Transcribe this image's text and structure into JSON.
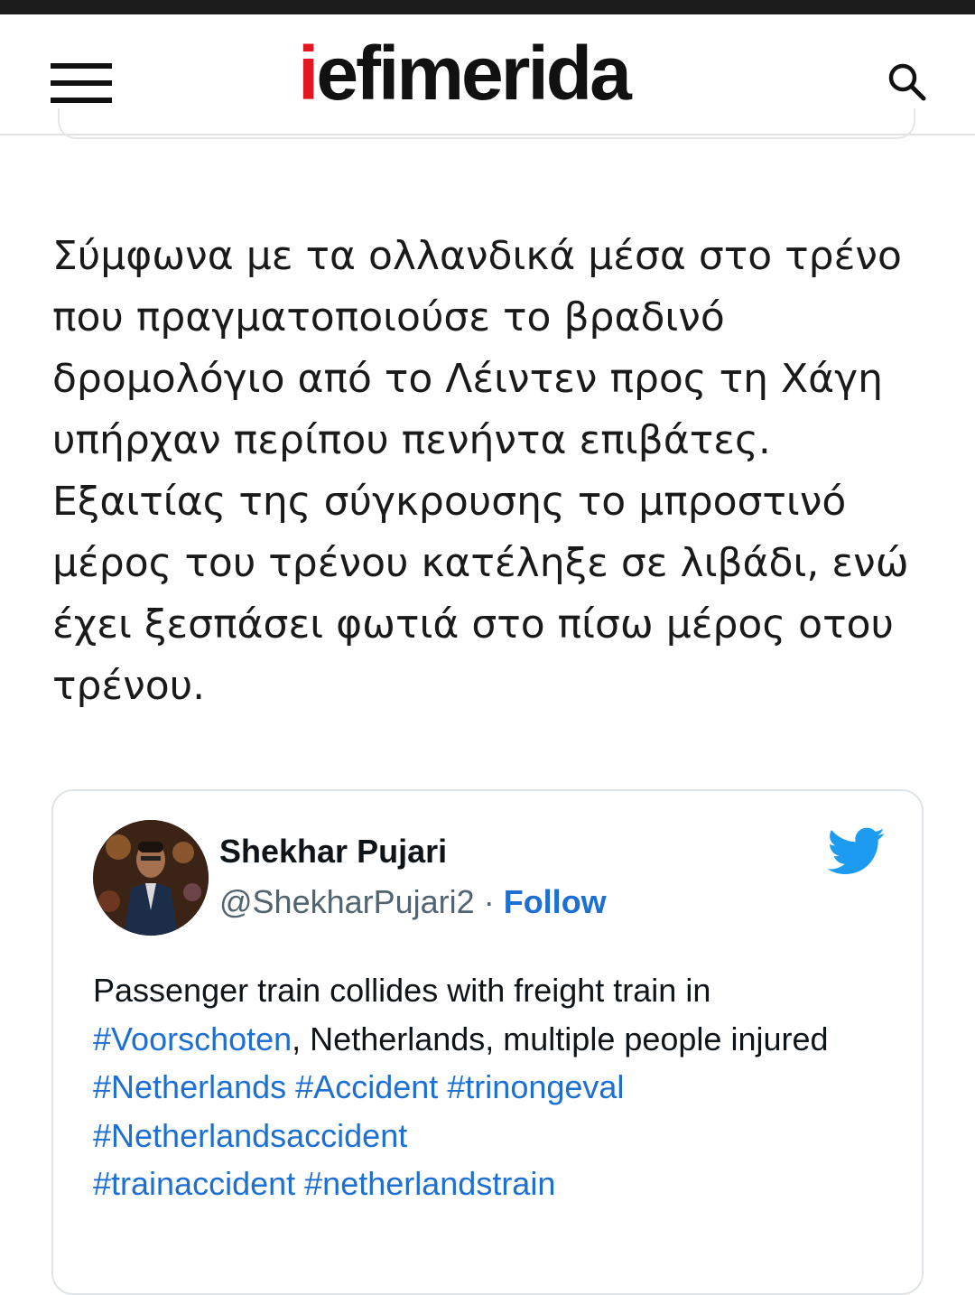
{
  "header": {
    "logo_accent": "i",
    "logo_rest": "efimerida",
    "accent_color": "#e3171f"
  },
  "article": {
    "paragraph": "Σύμφωνα με τα ολλανδικά μέσα στο τρένο που πραγματοποιούσε το βραδινό δρομολόγιο από το Λέιντεν προς τη Χάγη υπήρχαν περίπου πενήντα επιβάτες. Εξαιτίας της σύγκρουσης το μπροστινό μέρος του τρένου κατέληξε σε λιβάδι, ενώ έχει ξεσπάσει φωτιά στο πίσω μέρος οτου τρένου."
  },
  "tweet": {
    "author_name": "Shekhar Pujari",
    "handle": "@ShekharPujari2",
    "separator": "·",
    "follow_label": "Follow",
    "link_color": "#1d6fd1",
    "text_part1": "Passenger train collides with freight train in ",
    "hashtag_voorschoten": "#Voorschoten",
    "text_part2": ", Netherlands, multiple people injured",
    "hashtags_line1": [
      "#Netherlands",
      "#Accident",
      "#trinongeval"
    ],
    "hashtags_line2": [
      "#Netherlandsaccident"
    ],
    "hashtags_line3": [
      "#trainaccident",
      "#netherlandstrain"
    ]
  }
}
